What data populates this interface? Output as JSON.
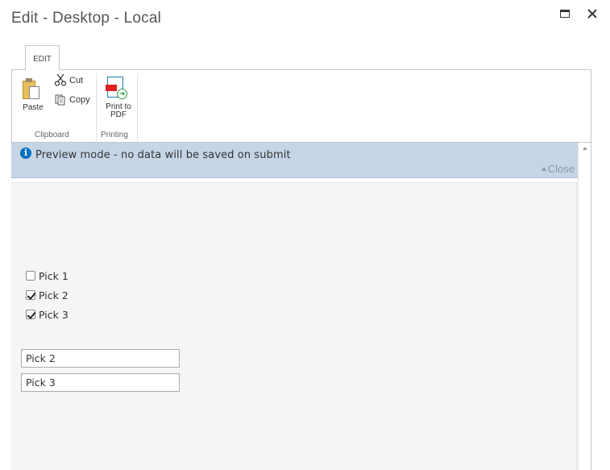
{
  "window": {
    "title": "Edit - Desktop - Local"
  },
  "ribbon": {
    "tab_label": "EDIT",
    "clipboard": {
      "label": "Clipboard",
      "paste": "Paste",
      "cut": "Cut",
      "copy": "Copy"
    },
    "printing": {
      "label": "Printing",
      "print_line1": "Print to",
      "print_line2": "PDF"
    }
  },
  "notice": {
    "text": "Preview mode - no data will be saved on submit",
    "close": "Close"
  },
  "form": {
    "checkboxes": [
      {
        "label": "Pick 1",
        "checked": false
      },
      {
        "label": "Pick 2",
        "checked": true
      },
      {
        "label": "Pick 3",
        "checked": true
      }
    ],
    "fields": [
      {
        "value": "Pick 2"
      },
      {
        "value": "Pick 3"
      }
    ]
  },
  "colors": {
    "notice_bg": "#c5d5e6",
    "info_icon": "#0070c0",
    "pdf_red": "#e02020"
  }
}
